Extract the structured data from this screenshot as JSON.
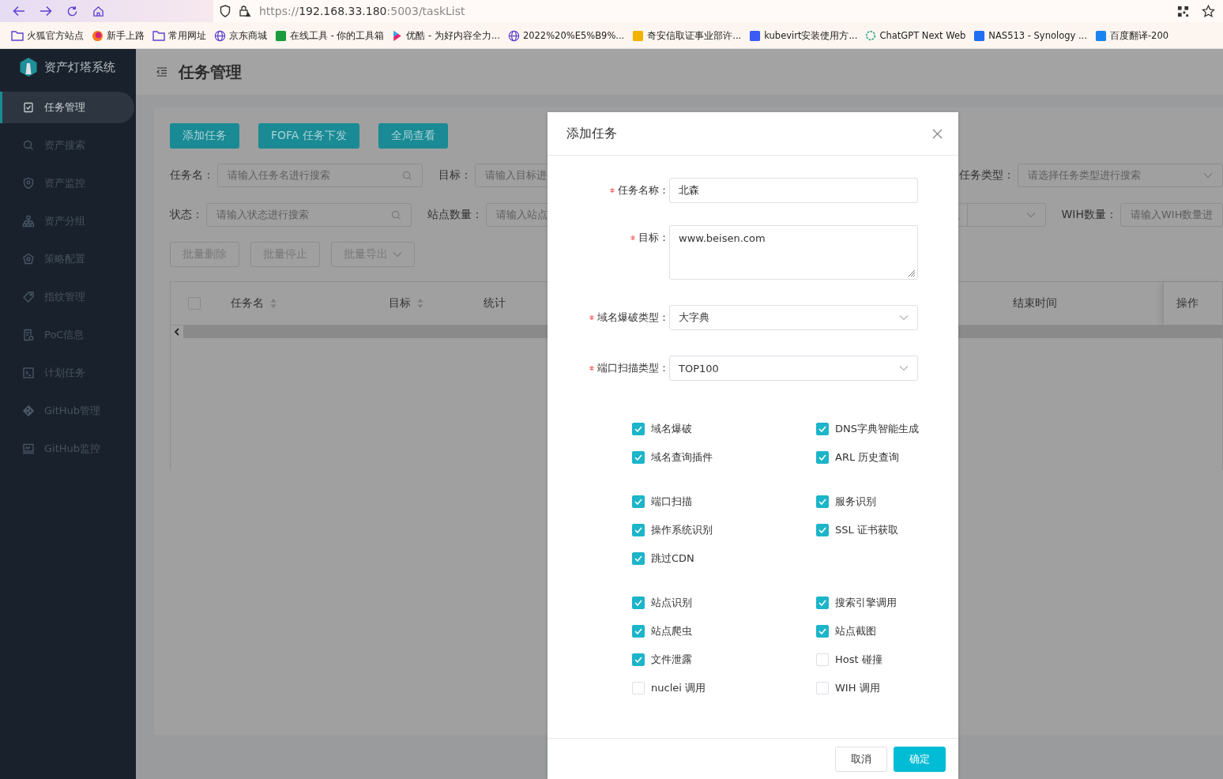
{
  "browser": {
    "url": {
      "scheme": "https://",
      "host": "192.168.33.180",
      "rest": ":5003/taskList"
    },
    "bookmarks": [
      "火狐官方站点",
      "新手上路",
      "常用网址",
      "京东商城",
      "在线工具 - 你的工具箱",
      "优酷 - 为好内容全力...",
      "2022%20%E5%B9%...",
      "奇安信取证事业部许...",
      "kubevirt安装使用方...",
      "ChatGPT Next Web",
      "NAS513 - Synology ...",
      "百度翻译-200"
    ]
  },
  "sidebar": {
    "title": "资产灯塔系统",
    "items": [
      {
        "label": "任务管理",
        "selected": true
      },
      {
        "label": "资产搜索",
        "selected": false
      },
      {
        "label": "资产监控",
        "selected": false
      },
      {
        "label": "资产分组",
        "selected": false
      },
      {
        "label": "策略配置",
        "selected": false
      },
      {
        "label": "指纹管理",
        "selected": false
      },
      {
        "label": "PoC信息",
        "selected": false
      },
      {
        "label": "计划任务",
        "selected": false
      },
      {
        "label": "GitHub管理",
        "selected": false
      },
      {
        "label": "GitHub监控",
        "selected": false
      }
    ]
  },
  "header": {
    "title": "任务管理"
  },
  "toolbar": [
    "添加任务",
    "FOFA 任务下发",
    "全局查看"
  ],
  "filters": [
    [
      {
        "kind": "search",
        "label": "任务名：",
        "placeholder": "请输入任务名进行搜索"
      },
      {
        "kind": "text",
        "label": "目标：",
        "placeholder": "请输入目标进"
      },
      {
        "kind": "select",
        "label": "任务类型：",
        "placeholder": "请选择任务类型进行搜索"
      }
    ],
    [
      {
        "kind": "search",
        "label": "状态：",
        "placeholder": "请输入状态进行搜索"
      },
      {
        "kind": "text",
        "label": "站点数量：",
        "placeholder": "请输入站点"
      },
      {
        "kind": "search-select"
      },
      {
        "kind": "text",
        "label": "WIH数量：",
        "placeholder": "请输入WIH数量进"
      }
    ]
  ],
  "batch_actions": [
    {
      "label": "批量删除",
      "kind": "plain",
      "disabled": true
    },
    {
      "label": "批量停止",
      "kind": "plain",
      "disabled": true
    },
    {
      "label": "批量导出",
      "kind": "dropdown",
      "disabled": true
    }
  ],
  "table": {
    "select_all": {
      "checked": false
    },
    "columns": [
      {
        "label": "任务名",
        "sortable": true
      },
      {
        "label": "目标",
        "sortable": true
      },
      {
        "label": "统计",
        "sortable": false
      },
      {
        "label": "结束时间",
        "sortable": false
      },
      {
        "label": "操作",
        "sortable": false
      }
    ]
  },
  "modal": {
    "title": "添加任务",
    "fields": [
      {
        "kind": "input",
        "label": "任务名称：",
        "required": true,
        "value": "北森"
      },
      {
        "kind": "textarea",
        "label": "目标：",
        "required": true,
        "value": "www.beisen.com"
      },
      {
        "kind": "select",
        "label": "域名爆破类型：",
        "required": true,
        "value": "大字典"
      },
      {
        "kind": "select",
        "label": "端口扫描类型：",
        "required": true,
        "value": "TOP100"
      }
    ],
    "option_groups": [
      [
        {
          "label": "域名爆破",
          "checked": true
        },
        {
          "label": "DNS字典智能生成",
          "checked": true
        },
        {
          "label": "域名查询插件",
          "checked": true
        },
        {
          "label": "ARL 历史查询",
          "checked": true
        }
      ],
      [
        {
          "label": "端口扫描",
          "checked": true
        },
        {
          "label": "服务识别",
          "checked": true
        },
        {
          "label": "操作系统识别",
          "checked": true
        },
        {
          "label": "SSL 证书获取",
          "checked": true
        },
        {
          "label": "跳过CDN",
          "checked": true
        }
      ],
      [
        {
          "label": "站点识别",
          "checked": true
        },
        {
          "label": "搜索引擎调用",
          "checked": true
        },
        {
          "label": "站点爬虫",
          "checked": true
        },
        {
          "label": "站点截图",
          "checked": true
        },
        {
          "label": "文件泄露",
          "checked": true
        },
        {
          "label": "Host 碰撞",
          "checked": false
        },
        {
          "label": "nuclei 调用",
          "checked": false
        },
        {
          "label": "WIH 调用",
          "checked": false
        }
      ]
    ],
    "buttons": [
      {
        "label": "取消",
        "kind": "default"
      },
      {
        "label": "确定",
        "kind": "primary"
      }
    ]
  }
}
